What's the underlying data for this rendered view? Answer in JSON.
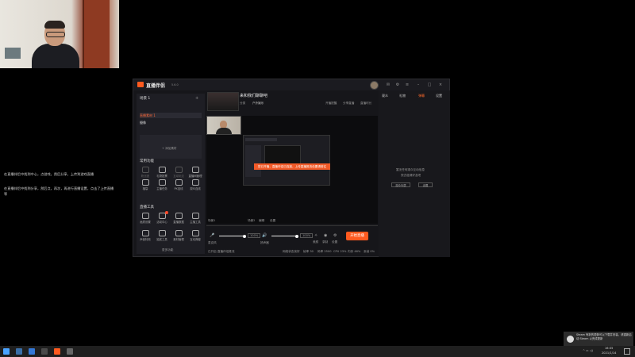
{
  "side_notes": {
    "line1": "在直播伴侣中找到中心，点游戏，然后分享，上传到游戏直播",
    "line2": "在直播伴侣中找到分享，然后点，再次，再进行直播设置，点击了上传直播等"
  },
  "app": {
    "brand": "直播伴侣",
    "version": "5.6.0",
    "left_panel": {
      "title": "场景 1",
      "scenes": [
        "直播素材 1",
        "摄像"
      ],
      "add_source": "+ 添加素材",
      "section_common": "常用功能",
      "common_tools": [
        {
          "label": "粉丝团"
        },
        {
          "label": "礼物投票"
        },
        {
          "label": "互动玩法"
        },
        {
          "label": "直播间管理"
        },
        {
          "label": "福袋"
        },
        {
          "label": "主播任务"
        },
        {
          "label": "PK连线"
        },
        {
          "label": "观众连线"
        }
      ],
      "section_tools": "直播工具",
      "tools": [
        {
          "label": "画质设置"
        },
        {
          "label": "活动中心"
        },
        {
          "label": "直播数据"
        },
        {
          "label": "主播工具"
        },
        {
          "label": "声音特效"
        },
        {
          "label": "抽奖工具"
        },
        {
          "label": "素材管理"
        },
        {
          "label": "互动弹幕"
        }
      ],
      "more_tools": "更多功能"
    },
    "middle": {
      "stream_title": "来和我们聊聊吧",
      "category_label": "分类",
      "category_value": "户外娱乐",
      "stat_labels": [
        "开播提醒",
        "分享直播",
        "直播时长"
      ],
      "overlay_banner": "您已开播，直播伴侣已连接，上传直播推流设置请前往",
      "scene_controls": [
        "场景1",
        "场景2",
        "编辑",
        "设置"
      ],
      "mic_label": "麦克风",
      "mic_value": "100%",
      "speaker_label": "扬声器",
      "speaker_value": "100%",
      "toggles": [
        "美颜",
        "录制",
        "设置"
      ],
      "go_live": "开始直播",
      "status_items": [
        "网络状态良好",
        "帧率 30",
        "码率 2500",
        "CPU 23%",
        "内存 46%",
        "丢帧 0%"
      ],
      "notice": "已开启 直播伴侣推流"
    },
    "right_panel": {
      "tabs": [
        "观众",
        "礼物",
        "弹幕",
        "设置"
      ],
      "empty_text_1": "暂无任何观众互动信息",
      "empty_text_2": "快去邀请好友吧",
      "button_1": "观众列表",
      "button_2": "设置"
    }
  },
  "taskbar": {
    "time": "16:35",
    "date": "2021/1/14",
    "toast": "Steam 有新的更新可以下载并安装，请重新启动 Steam 以完成更新"
  },
  "colors": {
    "accent": "#ff5a1f",
    "panel": "#1e1e24",
    "bg": "#000000"
  }
}
